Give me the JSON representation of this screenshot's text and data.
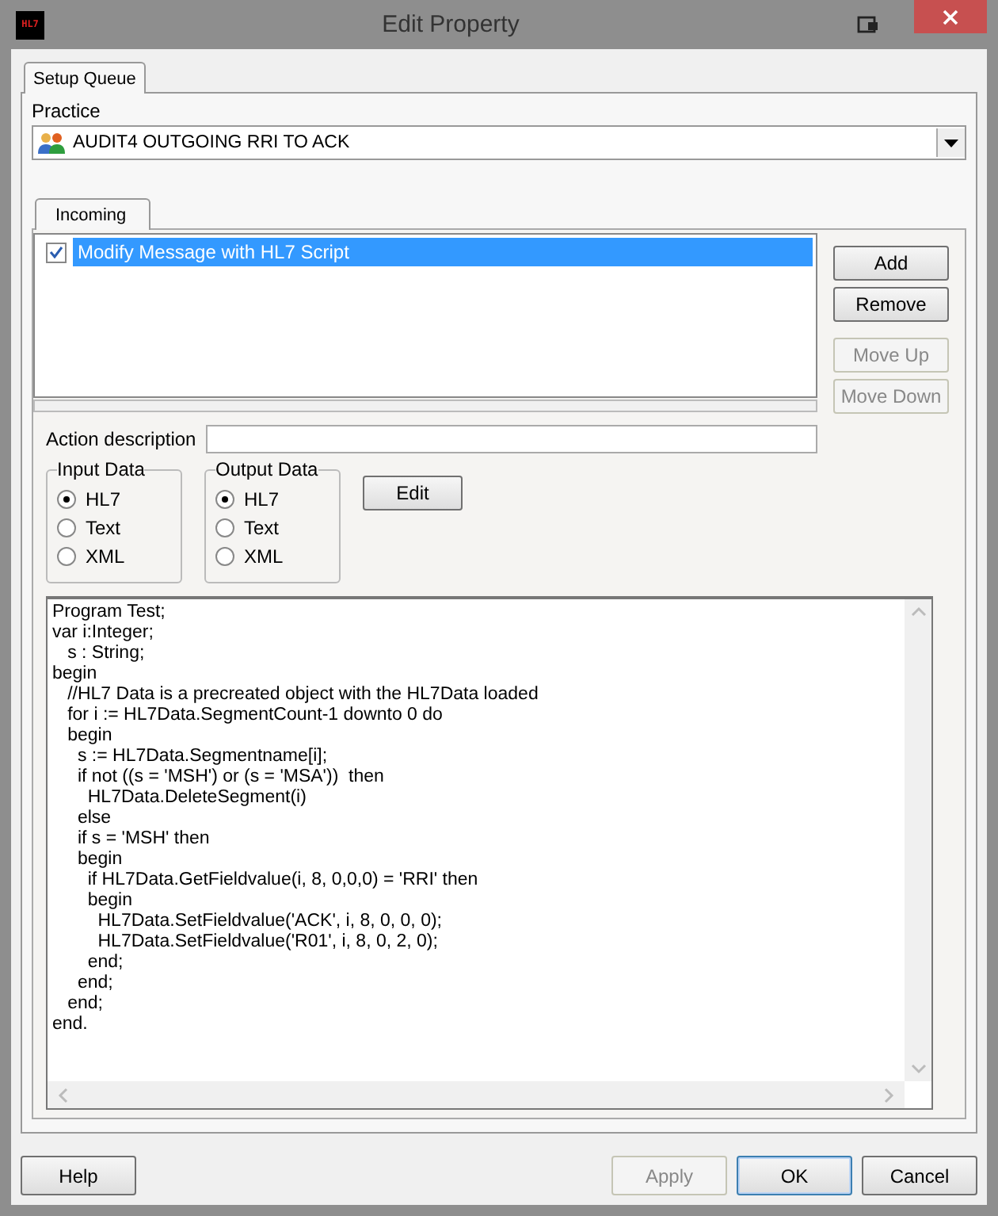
{
  "window": {
    "logo": "HL7",
    "title": "Edit Property"
  },
  "tabs": [
    {
      "label": "Setup Queue",
      "selected": true
    }
  ],
  "practice": {
    "label": "Practice",
    "value": "AUDIT4 OUTGOING RRI TO ACK"
  },
  "inner_tabs": [
    {
      "label": "Incoming",
      "selected": true
    }
  ],
  "actions": [
    {
      "label": "Modify Message with HL7 Script",
      "checked": true,
      "selected": true
    }
  ],
  "side_buttons": [
    {
      "label": "Add",
      "disabled": false
    },
    {
      "label": "Remove",
      "disabled": false
    },
    {
      "label": "Move Up",
      "disabled": true
    },
    {
      "label": "Move Down",
      "disabled": true
    }
  ],
  "action_description": {
    "label": "Action description"
  },
  "groups": [
    {
      "title": "Input Data",
      "options": [
        {
          "label": "HL7",
          "selected": true
        },
        {
          "label": "Text",
          "selected": false
        },
        {
          "label": "XML",
          "selected": false
        }
      ]
    },
    {
      "title": "Output Data",
      "options": [
        {
          "label": "HL7",
          "selected": true
        },
        {
          "label": "Text",
          "selected": false
        },
        {
          "label": "XML",
          "selected": false
        }
      ]
    }
  ],
  "edit_button": "Edit",
  "script_lines": [
    "Program Test;",
    "var i:Integer;",
    "   s : String;",
    "begin",
    "   //HL7 Data is a precreated object with the HL7Data loaded",
    "   for i := HL7Data.SegmentCount-1 downto 0 do",
    "   begin",
    "     s := HL7Data.Segmentname[i];",
    "     if not ((s = 'MSH') or (s = 'MSA'))  then",
    "       HL7Data.DeleteSegment(i)",
    "     else",
    "     if s = 'MSH' then",
    "     begin",
    "       if HL7Data.GetFieldvalue(i, 8, 0,0,0) = 'RRI' then",
    "       begin",
    "         HL7Data.SetFieldvalue('ACK', i, 8, 0, 0, 0);",
    "         HL7Data.SetFieldvalue('R01', i, 8, 0, 2, 0);",
    "       end;",
    "     end;",
    "   end;",
    "end."
  ],
  "footer_buttons": [
    {
      "label": "Help",
      "disabled": false,
      "default": false
    },
    {
      "label": "Apply",
      "disabled": true,
      "default": false
    },
    {
      "label": "OK",
      "disabled": false,
      "default": true
    },
    {
      "label": "Cancel",
      "disabled": false,
      "default": false
    }
  ]
}
